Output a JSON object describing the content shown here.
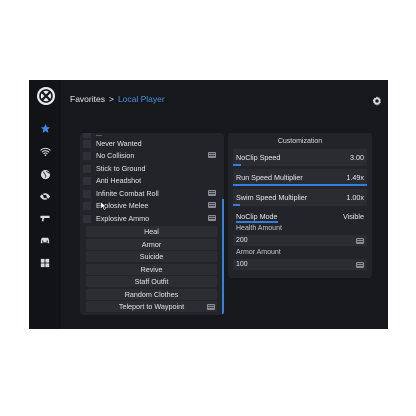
{
  "header": {
    "breadcrumb_root": "Favorites",
    "breadcrumb_separator": ">",
    "breadcrumb_current": "Local Player"
  },
  "sidebar": {
    "items": [
      {
        "icon": "star-icon",
        "active": true
      },
      {
        "icon": "wifi-icon",
        "active": false
      },
      {
        "icon": "globe-icon",
        "active": false
      },
      {
        "icon": "eye-icon",
        "active": false
      },
      {
        "icon": "gun-icon",
        "active": false
      },
      {
        "icon": "car-icon",
        "active": false
      },
      {
        "icon": "grid-icon",
        "active": false
      }
    ]
  },
  "options": {
    "partial_label": "...",
    "toggles": [
      {
        "label": "Never Wanted",
        "hotkey": false
      },
      {
        "label": "No Collision",
        "hotkey": true
      },
      {
        "label": "Stick to Ground",
        "hotkey": false
      },
      {
        "label": "Anti Headshot",
        "hotkey": false
      },
      {
        "label": "Infinite Combat Roll",
        "hotkey": true
      },
      {
        "label": "Explosive Melee",
        "hotkey": true
      },
      {
        "label": "Explosive Ammo",
        "hotkey": true
      }
    ],
    "buttons": [
      {
        "label": "Heal",
        "hotkey": false
      },
      {
        "label": "Armor",
        "hotkey": false
      },
      {
        "label": "Suicide",
        "hotkey": false
      },
      {
        "label": "Revive",
        "hotkey": false
      },
      {
        "label": "Staff Outfit",
        "hotkey": false
      },
      {
        "label": "Random Clothes",
        "hotkey": false
      },
      {
        "label": "Teleport to Waypoint",
        "hotkey": true
      }
    ]
  },
  "customization": {
    "title": "Customization",
    "sliders": [
      {
        "label": "NoClip Speed",
        "value": "3.00",
        "fill": 0.06
      },
      {
        "label": "Run Speed Multiplier",
        "value": "1.49x",
        "fill": 1.0
      },
      {
        "label": "Swim Speed Multiplier",
        "value": "1.00x",
        "fill": 0.05
      }
    ],
    "mode": {
      "label": "NoClip Mode",
      "value": "Visible"
    },
    "fields": [
      {
        "caption": "Health Amount",
        "value": "200"
      },
      {
        "caption": "Armor Amount",
        "value": "100"
      }
    ]
  },
  "colors": {
    "accent": "#2f7fe0",
    "breadcrumb_current": "#4a8fe2",
    "window_bg": "#17181b",
    "panel_bg": "#222429"
  }
}
